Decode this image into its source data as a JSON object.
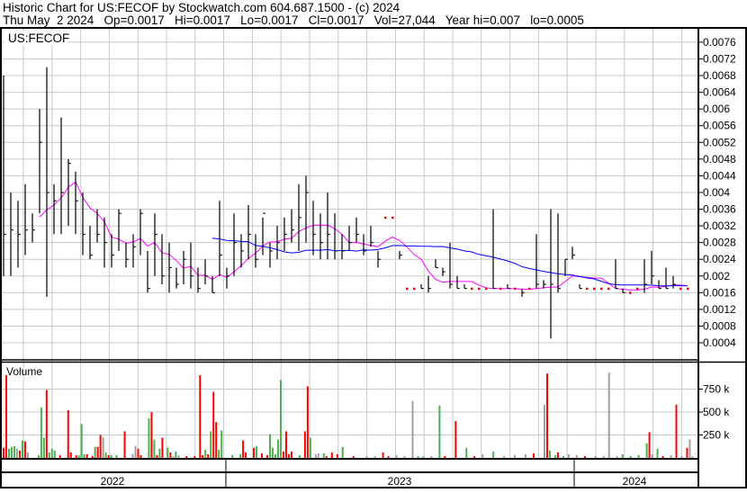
{
  "header": {
    "line1": "Historic Chart for US:FECOF by Stockwatch.com 604.687.1500 - (c) 2024",
    "line2": "Thu May  2 2024   Op=0.0017   Hi=0.0017   Lo=0.0017   Cl=0.0017   Vol=27,044   Year hi=0.007   lo=0.0005"
  },
  "colors": {
    "up": "#4caf50",
    "down": "#ff0000",
    "neutral": "#a0a0a0",
    "ma_long": "#0000ff",
    "ma_short": "#ff00ff",
    "grid": "#c8c8c8"
  },
  "chart_data": {
    "type": "ohlc",
    "symbol_label": "US:FECOF",
    "volume_label": "Volume",
    "price_ticks": [
      "0.0076",
      "0.0072",
      "0.0068",
      "0.0064",
      "0.006",
      "0.0056",
      "0.0052",
      "0.0048",
      "0.0044",
      "0.004",
      "0.0036",
      "0.0032",
      "0.0028",
      "0.0024",
      "0.002",
      "0.0016",
      "0.0012",
      "0.0008",
      "0.0004"
    ],
    "ylim": [
      0.0004,
      0.0076
    ],
    "volume_ticks": [
      "750 k",
      "500 k",
      "250 k"
    ],
    "volume_ylim": [
      0,
      1000
    ],
    "years": [
      "2022",
      "2023",
      "2024"
    ],
    "bars_hi": [
      0.0068,
      0.004,
      0.0038,
      0.0042,
      0.0035,
      0.006,
      0.007,
      0.0042,
      0.0058,
      0.0048,
      0.0045,
      0.004,
      0.0032,
      0.0036,
      0.0034,
      0.003,
      0.0036,
      0.0028,
      0.003,
      0.0036,
      0.0026,
      0.0035,
      0.003,
      0.0028,
      0.0022,
      0.0026,
      0.0028,
      0.0022,
      0.0024,
      0.002,
      0.0038,
      0.0022,
      0.0035,
      0.003,
      0.0037,
      0.003,
      0.0034,
      0.0028,
      0.0032,
      0.0034,
      0.0036,
      0.0042,
      0.0044,
      0.0038,
      0.0035,
      0.004,
      0.0035,
      0.003,
      0.0032,
      0.0034,
      0.003,
      0.0032,
      0.0026,
      0.0034,
      0.0034,
      0.0026,
      0.0017,
      0.0017,
      0.0018,
      0.002,
      0.0024,
      0.0022,
      0.0028,
      0.002,
      0.0018,
      0.0017,
      0.0017,
      0.0017,
      0.0036,
      0.0017,
      0.0018,
      0.0017,
      0.0017,
      0.0017,
      0.003,
      0.0019,
      0.0036,
      0.0035,
      0.0024,
      0.0027,
      0.0018,
      0.0017,
      0.0017,
      0.0017,
      0.0017,
      0.0024,
      0.0017,
      0.0016,
      0.0017,
      0.0024,
      0.0026,
      0.0019,
      0.0022,
      0.002,
      0.0017,
      0.0017
    ],
    "bars_lo": [
      0.002,
      0.002,
      0.0022,
      0.0025,
      0.0028,
      0.0035,
      0.0015,
      0.003,
      0.003,
      0.0032,
      0.003,
      0.0025,
      0.0024,
      0.0028,
      0.0022,
      0.0022,
      0.0026,
      0.0022,
      0.0022,
      0.0025,
      0.0016,
      0.002,
      0.0018,
      0.0016,
      0.0017,
      0.0018,
      0.0017,
      0.0016,
      0.0018,
      0.0016,
      0.002,
      0.0017,
      0.002,
      0.0022,
      0.0024,
      0.0022,
      0.0025,
      0.0022,
      0.0024,
      0.0026,
      0.0028,
      0.0026,
      0.0028,
      0.0025,
      0.0024,
      0.0024,
      0.0024,
      0.0024,
      0.0026,
      0.0028,
      0.0025,
      0.0027,
      0.0022,
      0.0034,
      0.0034,
      0.0024,
      0.0017,
      0.0017,
      0.0017,
      0.0016,
      0.0022,
      0.002,
      0.0017,
      0.0017,
      0.0017,
      0.0017,
      0.0017,
      0.0017,
      0.0017,
      0.0017,
      0.0017,
      0.0017,
      0.0015,
      0.0017,
      0.0017,
      0.0017,
      0.0005,
      0.0016,
      0.002,
      0.0024,
      0.0017,
      0.0017,
      0.0017,
      0.0017,
      0.0017,
      0.0017,
      0.0016,
      0.0016,
      0.0017,
      0.0016,
      0.0018,
      0.0017,
      0.0017,
      0.0017,
      0.0017,
      0.0017
    ],
    "bars_cl": [
      0.003,
      0.0031,
      0.003,
      0.0031,
      0.0031,
      0.0052,
      0.004,
      0.0038,
      0.004,
      0.0047,
      0.0038,
      0.003,
      0.0025,
      0.003,
      0.0028,
      0.0025,
      0.0035,
      0.0024,
      0.0027,
      0.0035,
      0.0017,
      0.003,
      0.002,
      0.0022,
      0.0018,
      0.0024,
      0.002,
      0.0017,
      0.002,
      0.0016,
      0.0025,
      0.002,
      0.0028,
      0.0026,
      0.003,
      0.0024,
      0.0035,
      0.0026,
      0.0028,
      0.003,
      0.0031,
      0.0034,
      0.004,
      0.003,
      0.0028,
      0.003,
      0.0026,
      0.0026,
      0.0028,
      0.003,
      0.0026,
      0.0028,
      0.0024,
      0.0034,
      0.0034,
      0.0025,
      0.0017,
      0.0017,
      0.0017,
      0.0017,
      0.0022,
      0.0021,
      0.0018,
      0.0017,
      0.0017,
      0.0017,
      0.0017,
      0.0017,
      0.0017,
      0.0017,
      0.0017,
      0.0017,
      0.0016,
      0.0017,
      0.0018,
      0.0018,
      0.0018,
      0.0017,
      0.0024,
      0.0025,
      0.0017,
      0.0017,
      0.0017,
      0.0017,
      0.0017,
      0.0017,
      0.0016,
      0.0016,
      0.0017,
      0.0018,
      0.002,
      0.0017,
      0.0017,
      0.0018,
      0.0017,
      0.0017
    ],
    "ma_long_period": 30,
    "ma_short_period": 6,
    "volume_k": [
      [
        1,
        900,
        "d"
      ],
      [
        0,
        110,
        "d"
      ],
      [
        2,
        100,
        "u"
      ],
      [
        3,
        120,
        "u"
      ],
      [
        4,
        130,
        "u"
      ],
      [
        5,
        100,
        "n"
      ],
      [
        6,
        80,
        "d"
      ],
      [
        7,
        190,
        "u"
      ],
      [
        8,
        180,
        "d"
      ],
      [
        9,
        60,
        "n"
      ],
      [
        13,
        30,
        "u"
      ],
      [
        14,
        550,
        "u"
      ],
      [
        15,
        220,
        "u"
      ],
      [
        16,
        740,
        "d"
      ],
      [
        17,
        60,
        "u"
      ],
      [
        18,
        100,
        "u"
      ],
      [
        19,
        80,
        "u"
      ],
      [
        21,
        30,
        "d"
      ],
      [
        24,
        520,
        "d"
      ],
      [
        25,
        60,
        "d"
      ],
      [
        27,
        30,
        "d"
      ],
      [
        28,
        30,
        "u"
      ],
      [
        29,
        370,
        "u"
      ],
      [
        30,
        40,
        "u"
      ],
      [
        31,
        40,
        "d"
      ],
      [
        33,
        20,
        "d"
      ],
      [
        34,
        120,
        "u"
      ],
      [
        35,
        120,
        "d"
      ],
      [
        36,
        250,
        "d"
      ],
      [
        37,
        220,
        "n"
      ],
      [
        38,
        60,
        "u"
      ],
      [
        39,
        30,
        "d"
      ],
      [
        40,
        30,
        "u"
      ],
      [
        42,
        30,
        "u"
      ],
      [
        45,
        290,
        "d"
      ],
      [
        48,
        40,
        "n"
      ],
      [
        49,
        130,
        "n"
      ],
      [
        50,
        100,
        "d"
      ],
      [
        51,
        30,
        "d"
      ],
      [
        54,
        430,
        "u"
      ],
      [
        55,
        500,
        "d"
      ],
      [
        56,
        200,
        "u"
      ],
      [
        57,
        30,
        "d"
      ],
      [
        58,
        100,
        "u"
      ],
      [
        59,
        220,
        "d"
      ],
      [
        61,
        110,
        "u"
      ],
      [
        62,
        60,
        "d"
      ],
      [
        63,
        20,
        "n"
      ],
      [
        64,
        70,
        "u"
      ],
      [
        65,
        30,
        "n"
      ],
      [
        68,
        20,
        "d"
      ],
      [
        71,
        20,
        "d"
      ],
      [
        73,
        900,
        "d"
      ],
      [
        74,
        30,
        "d"
      ],
      [
        75,
        90,
        "u"
      ],
      [
        76,
        40,
        "d"
      ],
      [
        77,
        290,
        "u"
      ],
      [
        78,
        720,
        "d"
      ],
      [
        79,
        390,
        "d"
      ],
      [
        80,
        90,
        "u"
      ],
      [
        81,
        300,
        "u"
      ],
      [
        85,
        30,
        "u"
      ],
      [
        88,
        40,
        "u"
      ],
      [
        89,
        190,
        "d"
      ],
      [
        90,
        60,
        "d"
      ],
      [
        93,
        110,
        "d"
      ],
      [
        94,
        130,
        "u"
      ],
      [
        96,
        50,
        "d"
      ],
      [
        98,
        30,
        "d"
      ],
      [
        99,
        260,
        "u"
      ],
      [
        100,
        110,
        "u"
      ],
      [
        101,
        40,
        "u"
      ],
      [
        102,
        200,
        "u"
      ],
      [
        103,
        850,
        "u"
      ],
      [
        104,
        70,
        "d"
      ],
      [
        105,
        290,
        "d"
      ],
      [
        106,
        40,
        "d"
      ],
      [
        107,
        70,
        "d"
      ],
      [
        110,
        30,
        "u"
      ],
      [
        112,
        290,
        "d"
      ],
      [
        113,
        780,
        "d"
      ],
      [
        114,
        220,
        "u"
      ],
      [
        116,
        40,
        "n"
      ],
      [
        117,
        50,
        "n"
      ],
      [
        119,
        50,
        "u"
      ],
      [
        120,
        20,
        "d"
      ],
      [
        122,
        60,
        "d"
      ],
      [
        124,
        40,
        "d"
      ],
      [
        126,
        120,
        "u"
      ],
      [
        130,
        20,
        "d"
      ],
      [
        135,
        20,
        "n"
      ],
      [
        138,
        20,
        "n"
      ],
      [
        141,
        60,
        "d"
      ],
      [
        143,
        20,
        "d"
      ],
      [
        146,
        30,
        "n"
      ],
      [
        149,
        20,
        "n"
      ],
      [
        152,
        620,
        "n"
      ],
      [
        154,
        20,
        "u"
      ],
      [
        156,
        20,
        "n"
      ],
      [
        159,
        20,
        "n"
      ],
      [
        162,
        570,
        "u"
      ],
      [
        164,
        20,
        "d"
      ],
      [
        168,
        400,
        "d"
      ],
      [
        172,
        110,
        "u"
      ],
      [
        175,
        20,
        "d"
      ],
      [
        178,
        40,
        "n"
      ],
      [
        182,
        70,
        "u"
      ],
      [
        186,
        20,
        "n"
      ],
      [
        190,
        30,
        "n"
      ],
      [
        194,
        40,
        "n"
      ],
      [
        197,
        50,
        "d"
      ],
      [
        201,
        580,
        "n"
      ],
      [
        202,
        920,
        "d"
      ],
      [
        203,
        80,
        "u"
      ],
      [
        205,
        30,
        "u"
      ],
      [
        206,
        60,
        "d"
      ],
      [
        208,
        20,
        "u"
      ],
      [
        210,
        40,
        "n"
      ],
      [
        213,
        30,
        "n"
      ],
      [
        216,
        20,
        "d"
      ],
      [
        220,
        20,
        "n"
      ],
      [
        223,
        20,
        "n"
      ],
      [
        225,
        930,
        "n"
      ],
      [
        228,
        20,
        "n"
      ],
      [
        230,
        40,
        "u"
      ],
      [
        233,
        20,
        "u"
      ],
      [
        236,
        30,
        "u"
      ],
      [
        239,
        160,
        "u"
      ],
      [
        240,
        280,
        "d"
      ],
      [
        241,
        40,
        "n"
      ],
      [
        243,
        100,
        "u"
      ],
      [
        245,
        20,
        "d"
      ],
      [
        248,
        30,
        "n"
      ],
      [
        250,
        580,
        "d"
      ],
      [
        252,
        20,
        "n"
      ],
      [
        254,
        110,
        "d"
      ],
      [
        255,
        200,
        "n"
      ],
      [
        256,
        20,
        "n"
      ]
    ]
  }
}
